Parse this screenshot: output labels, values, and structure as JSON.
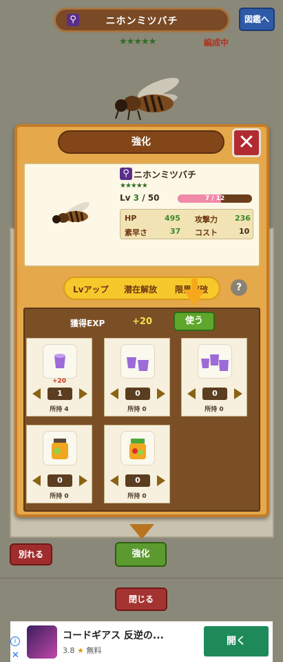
{
  "header": {
    "bee_name": "ニホンミツバチ",
    "zukan_label": "図鑑へ",
    "stars": "★★★★★",
    "formation_label": "編成中"
  },
  "dialog": {
    "title": "強化",
    "close_label": "✕",
    "bee": {
      "name": "ニホンミツバチ",
      "stars": "★★★★★",
      "lv_label": "Lv",
      "lv_current": "3",
      "lv_max": "/ 50",
      "exp_text": "7 / 12",
      "exp_fraction": 0.58,
      "stats": [
        {
          "label": "HP",
          "value": "495"
        },
        {
          "label": "攻撃力",
          "value": "236"
        },
        {
          "label": "素早さ",
          "value": "37"
        },
        {
          "label": "コスト",
          "value": "10"
        }
      ]
    },
    "tabs": [
      "Lvアップ",
      "潜在解放",
      "限界突破"
    ],
    "help": "?",
    "exp_label": "獲得EXP",
    "exp_gain": "+20",
    "use_label": "使う",
    "items": [
      {
        "icon": "purple-cup-icon",
        "plus": "+20",
        "count": "1",
        "owned": "所持 4"
      },
      {
        "icon": "two-purple-cups-icon",
        "plus": "",
        "count": "0",
        "owned": "所持 0"
      },
      {
        "icon": "three-purple-cups-icon",
        "plus": "",
        "count": "0",
        "owned": "所持 0"
      },
      {
        "icon": "honey-jar-icon",
        "plus": "",
        "count": "0",
        "owned": "所持 0"
      },
      {
        "icon": "green-honey-jar-icon",
        "plus": "",
        "count": "0",
        "owned": "所持 0"
      }
    ]
  },
  "bottom": {
    "leave_label": "別れる",
    "enhance_label": "強化",
    "close_label": "閉じる"
  },
  "ad": {
    "title": "コードギアス 反逆の...",
    "rating": "3.8",
    "star": "★",
    "price": "無料",
    "open_label": "開く"
  },
  "colors": {
    "accent_green": "#5c9a30",
    "accent_red": "#a43431",
    "panel_orange": "#e5a84a",
    "wood_brown": "#7b4f26"
  }
}
